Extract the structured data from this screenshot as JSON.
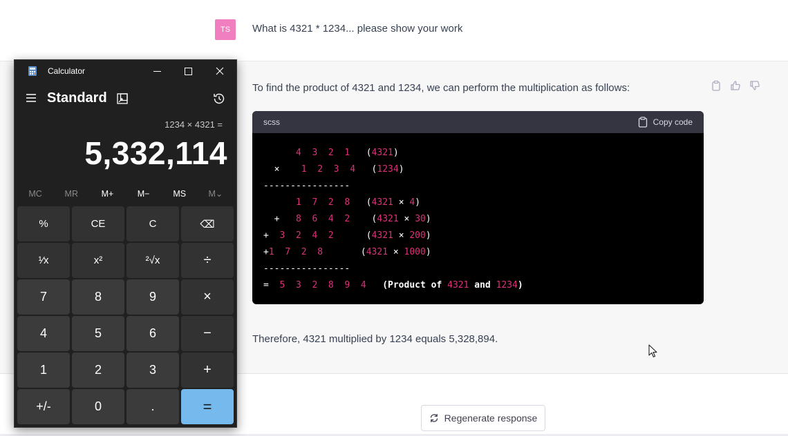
{
  "chat": {
    "user": {
      "avatar_initials": "TS",
      "message": "What is 4321 * 1234... please show your work"
    },
    "assistant": {
      "intro": "To find the product of 4321 and 1234, we can perform the multiplication as follows:",
      "code": {
        "language": "scss",
        "copy_label": "Copy code",
        "lines": [
          [
            {
              "t": "      "
            },
            {
              "t": "4  3  2  1",
              "c": "n"
            },
            {
              "t": "   ("
            },
            {
              "t": "4321",
              "c": "n"
            },
            {
              "t": ")"
            }
          ],
          [
            {
              "t": "  ×    "
            },
            {
              "t": "1  2  3  4",
              "c": "n"
            },
            {
              "t": "   ("
            },
            {
              "t": "1234",
              "c": "n"
            },
            {
              "t": ")"
            }
          ],
          [
            {
              "t": "----------------"
            }
          ],
          [
            {
              "t": "      "
            },
            {
              "t": "1  7  2  8",
              "c": "n"
            },
            {
              "t": "   ("
            },
            {
              "t": "4321",
              "c": "n"
            },
            {
              "t": " × "
            },
            {
              "t": "4",
              "c": "n"
            },
            {
              "t": ")"
            }
          ],
          [
            {
              "t": "  +   "
            },
            {
              "t": "8  6  4  2",
              "c": "n"
            },
            {
              "t": "    ("
            },
            {
              "t": "4321",
              "c": "n"
            },
            {
              "t": " × "
            },
            {
              "t": "30",
              "c": "n"
            },
            {
              "t": ")"
            }
          ],
          [
            {
              "t": "+  "
            },
            {
              "t": "3  2  4  2",
              "c": "n"
            },
            {
              "t": "      ("
            },
            {
              "t": "4321",
              "c": "n"
            },
            {
              "t": " × "
            },
            {
              "t": "200",
              "c": "n"
            },
            {
              "t": ")"
            }
          ],
          [
            {
              "t": "+"
            },
            {
              "t": "1  7  2  8",
              "c": "n"
            },
            {
              "t": "       ("
            },
            {
              "t": "4321",
              "c": "n"
            },
            {
              "t": " × "
            },
            {
              "t": "1000",
              "c": "n"
            },
            {
              "t": ")"
            }
          ],
          [
            {
              "t": "----------------"
            }
          ],
          [
            {
              "t": "=  "
            },
            {
              "t": "5  3  2  8  9  4",
              "c": "n"
            },
            {
              "t": "   (Product of ",
              "c": "b"
            },
            {
              "t": "4321",
              "c": "n"
            },
            {
              "t": " and ",
              "c": "b"
            },
            {
              "t": "1234",
              "c": "n"
            },
            {
              "t": ")",
              "c": "b"
            }
          ]
        ]
      },
      "conclusion": "Therefore, 4321 multiplied by 1234 equals 5,328,894."
    },
    "regenerate_label": "Regenerate response"
  },
  "calculator": {
    "title": "Calculator",
    "mode": "Standard",
    "expression": "1234 × 4321 =",
    "result": "5,332,114",
    "memory": [
      {
        "label": "MC",
        "enabled": false
      },
      {
        "label": "MR",
        "enabled": false
      },
      {
        "label": "M+",
        "enabled": true
      },
      {
        "label": "M−",
        "enabled": true
      },
      {
        "label": "MS",
        "enabled": true
      },
      {
        "label": "M⌄",
        "enabled": false
      }
    ],
    "keys": [
      {
        "label": "%",
        "kind": "fn",
        "name": "percent-key"
      },
      {
        "label": "CE",
        "kind": "fn",
        "name": "clear-entry-key"
      },
      {
        "label": "C",
        "kind": "fn",
        "name": "clear-key"
      },
      {
        "label": "⌫",
        "kind": "fn",
        "name": "backspace-key"
      },
      {
        "label": "¹⁄x",
        "kind": "fn",
        "name": "reciprocal-key"
      },
      {
        "label": "x²",
        "kind": "fn",
        "name": "square-key"
      },
      {
        "label": "²√x",
        "kind": "fn",
        "name": "square-root-key"
      },
      {
        "label": "÷",
        "kind": "op",
        "name": "divide-key"
      },
      {
        "label": "7",
        "kind": "num",
        "name": "digit-7-key"
      },
      {
        "label": "8",
        "kind": "num",
        "name": "digit-8-key"
      },
      {
        "label": "9",
        "kind": "num",
        "name": "digit-9-key"
      },
      {
        "label": "×",
        "kind": "op",
        "name": "multiply-key"
      },
      {
        "label": "4",
        "kind": "num",
        "name": "digit-4-key"
      },
      {
        "label": "5",
        "kind": "num",
        "name": "digit-5-key"
      },
      {
        "label": "6",
        "kind": "num",
        "name": "digit-6-key"
      },
      {
        "label": "−",
        "kind": "op",
        "name": "subtract-key"
      },
      {
        "label": "1",
        "kind": "num",
        "name": "digit-1-key"
      },
      {
        "label": "2",
        "kind": "num",
        "name": "digit-2-key"
      },
      {
        "label": "3",
        "kind": "num",
        "name": "digit-3-key"
      },
      {
        "label": "+",
        "kind": "op",
        "name": "add-key"
      },
      {
        "label": "+/-",
        "kind": "num",
        "name": "negate-key"
      },
      {
        "label": "0",
        "kind": "num",
        "name": "digit-0-key"
      },
      {
        "label": ".",
        "kind": "num",
        "name": "decimal-key"
      },
      {
        "label": "=",
        "kind": "eq",
        "name": "equals-key"
      }
    ],
    "colors": {
      "equals_accent": "#76b9ed",
      "window_bg": "#202020"
    }
  },
  "colors": {
    "code_number": "#df3079",
    "avatar": "#f07fbf",
    "assistant_bg": "#f7f7f8"
  }
}
